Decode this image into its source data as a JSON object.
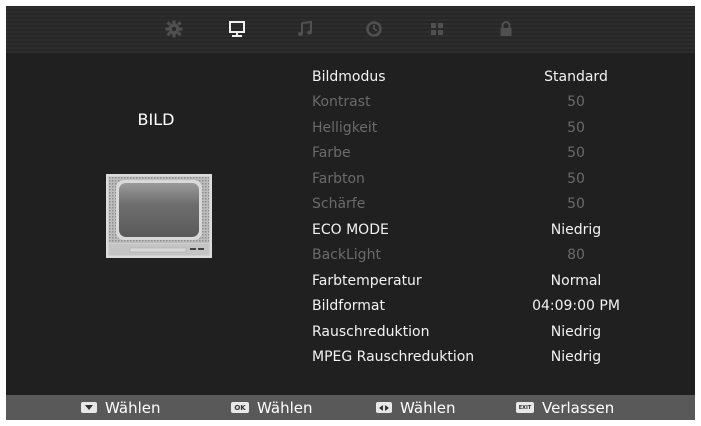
{
  "tabs": [
    {
      "icon": "gear-icon",
      "selected": false
    },
    {
      "icon": "monitor-icon",
      "selected": true
    },
    {
      "icon": "music-note-icon",
      "selected": false
    },
    {
      "icon": "clock-icon",
      "selected": false
    },
    {
      "icon": "grid-icon",
      "selected": false
    },
    {
      "icon": "lock-icon",
      "selected": false
    }
  ],
  "side": {
    "title": "BILD",
    "image_icon": "tv-icon"
  },
  "menu": [
    {
      "label": "Bildmodus",
      "value": "Standard",
      "enabled": true
    },
    {
      "label": "Kontrast",
      "value": "50",
      "enabled": false
    },
    {
      "label": "Helligkeit",
      "value": "50",
      "enabled": false
    },
    {
      "label": "Farbe",
      "value": "50",
      "enabled": false
    },
    {
      "label": "Farbton",
      "value": "50",
      "enabled": false
    },
    {
      "label": "Schärfe",
      "value": "50",
      "enabled": false
    },
    {
      "label": "ECO MODE",
      "value": "Niedrig",
      "enabled": true
    },
    {
      "label": "BackLight",
      "value": "80",
      "enabled": false
    },
    {
      "label": "Farbtemperatur",
      "value": "Normal",
      "enabled": true
    },
    {
      "label": "Bildformat",
      "value": "04:09:00 PM",
      "enabled": true
    },
    {
      "label": "Rauschreduktion",
      "value": "Niedrig",
      "enabled": true
    },
    {
      "label": "MPEG Rauschreduktion",
      "value": "Niedrig",
      "enabled": true
    }
  ],
  "footer": [
    {
      "key": "down-arrow",
      "key_label": "",
      "text": "Wählen"
    },
    {
      "key": "ok",
      "key_label": "OK",
      "text": "Wählen"
    },
    {
      "key": "left-right-arrows",
      "key_label": "",
      "text": "Wählen"
    },
    {
      "key": "exit",
      "key_label": "EXIT",
      "text": "Verlassen"
    }
  ],
  "colors": {
    "background": "#202020",
    "topbar": "#2a2a2a",
    "footer": "#595959",
    "text_active": "#f2f2f2",
    "text_dim": "#6a6a6a",
    "icon_dim": "#505050",
    "icon_active": "#f0f0f0"
  }
}
